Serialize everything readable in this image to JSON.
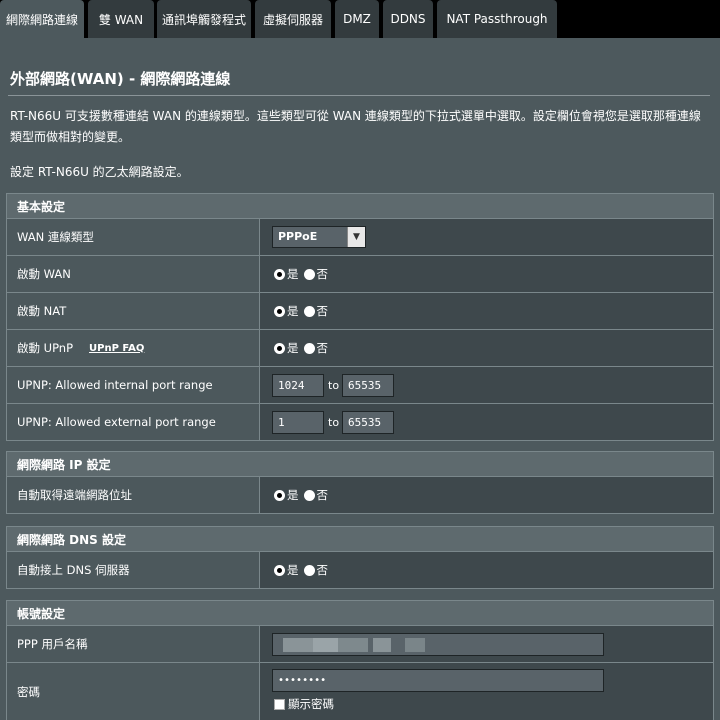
{
  "tabs": [
    {
      "label": "網際網路連線",
      "active": true
    },
    {
      "label": "雙 WAN"
    },
    {
      "label": "通訊埠觸發程式"
    },
    {
      "label": "虛擬伺服器"
    },
    {
      "label": "DMZ"
    },
    {
      "label": "DDNS"
    },
    {
      "label": "NAT Passthrough"
    }
  ],
  "page": {
    "title": "外部網路(WAN) - 網際網路連線",
    "description": "RT-N66U 可支援數種連結 WAN 的連線類型。這些類型可從 WAN 連線類型的下拉式選單中選取。設定欄位會視您是選取那種連線類型而做相對的變更。",
    "subtitle": "設定 RT-N66U 的乙太網路設定。"
  },
  "basic": {
    "header": "基本設定",
    "wan_type_label": "WAN 連線類型",
    "wan_type_value": "PPPoE",
    "enable_wan_label": "啟動 WAN",
    "enable_nat_label": "啟動 NAT",
    "enable_upnp_label": "啟動 UPnP",
    "upnp_faq": "UPnP  FAQ",
    "internal_range_label": "UPNP: Allowed internal port range",
    "internal_from": "1024",
    "internal_to": "65535",
    "external_range_label": "UPNP: Allowed external port range",
    "external_from": "1",
    "external_to": "65535",
    "to_label": "to"
  },
  "radio": {
    "yes": "是",
    "no": "否"
  },
  "ip": {
    "header": "網際網路 IP 設定",
    "auto_ip_label": "自動取得遠端網路位址"
  },
  "dns": {
    "header": "網際網路 DNS 設定",
    "auto_dns_label": "自動接上 DNS 伺服器"
  },
  "account": {
    "header": "帳號設定",
    "username_label": "PPP 用戶名稱",
    "password_label": "密碼",
    "password_value": "••••••••",
    "show_password": "顯示密碼"
  }
}
